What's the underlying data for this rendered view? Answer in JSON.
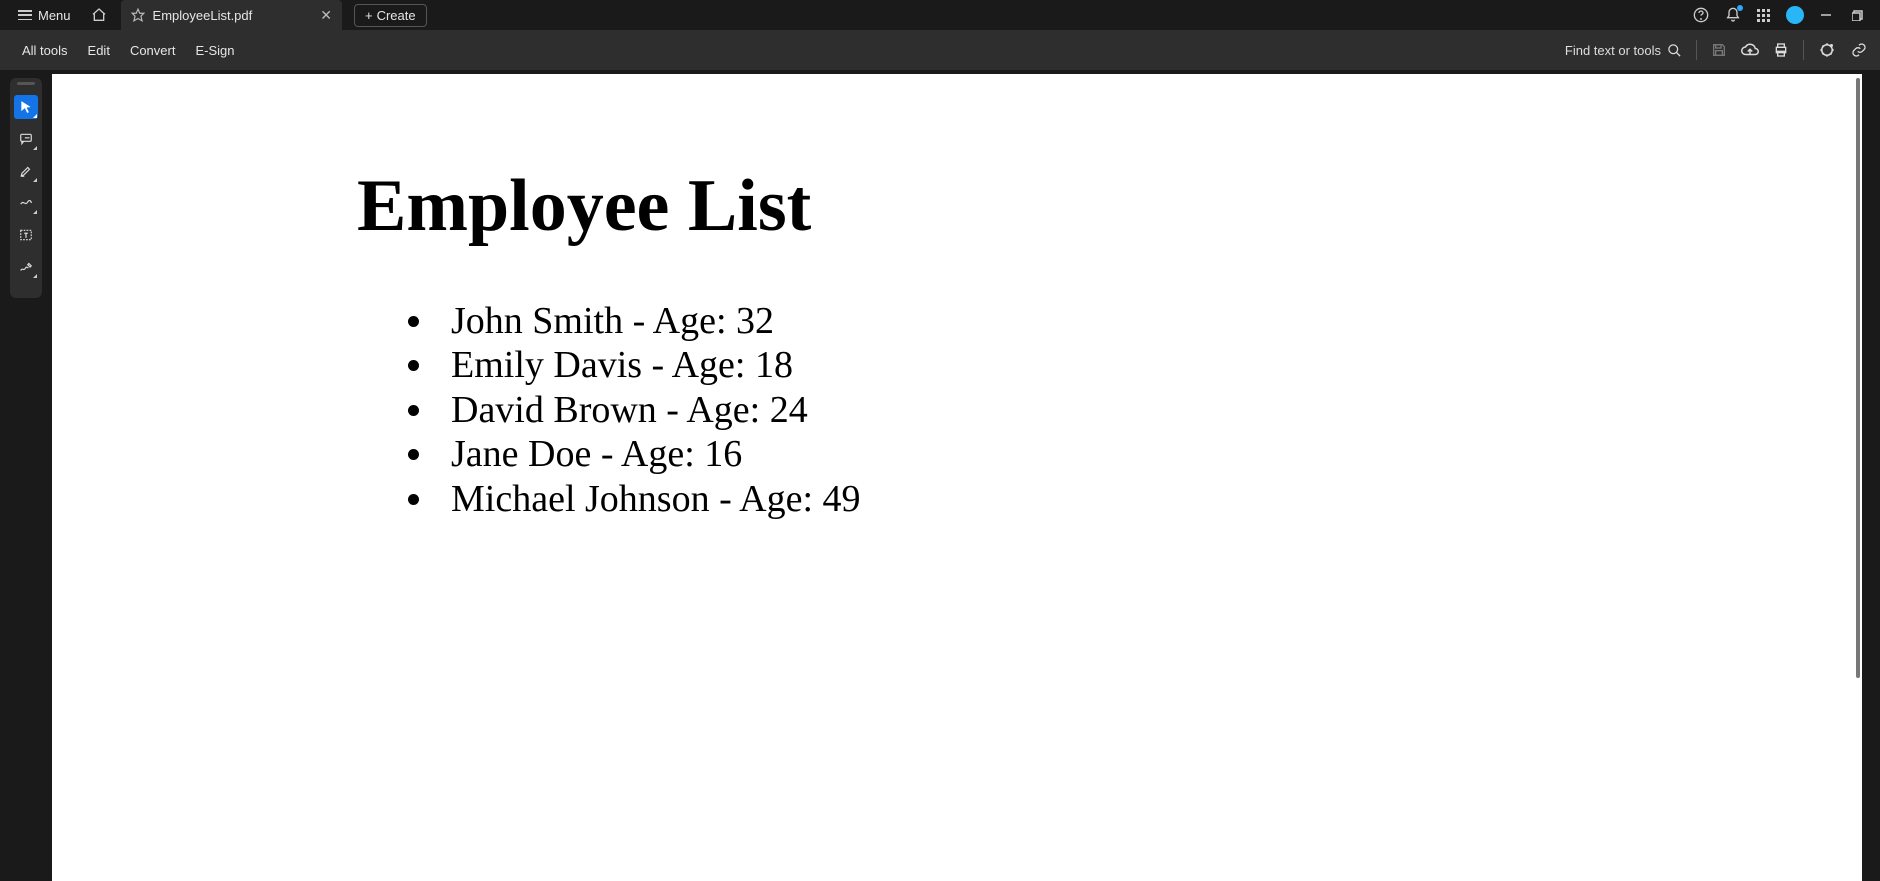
{
  "titlebar": {
    "menu_label": "Menu",
    "tab_title": "EmployeeList.pdf",
    "create_label": "Create"
  },
  "toolbar": {
    "items": [
      "All tools",
      "Edit",
      "Convert",
      "E-Sign"
    ],
    "find_label": "Find text or tools"
  },
  "document": {
    "title": "Employee List",
    "employees": [
      {
        "name": "John Smith",
        "age": 32
      },
      {
        "name": "Emily Davis",
        "age": 18
      },
      {
        "name": "David Brown",
        "age": 24
      },
      {
        "name": "Jane Doe",
        "age": 16
      },
      {
        "name": "Michael Johnson",
        "age": 49
      }
    ]
  }
}
